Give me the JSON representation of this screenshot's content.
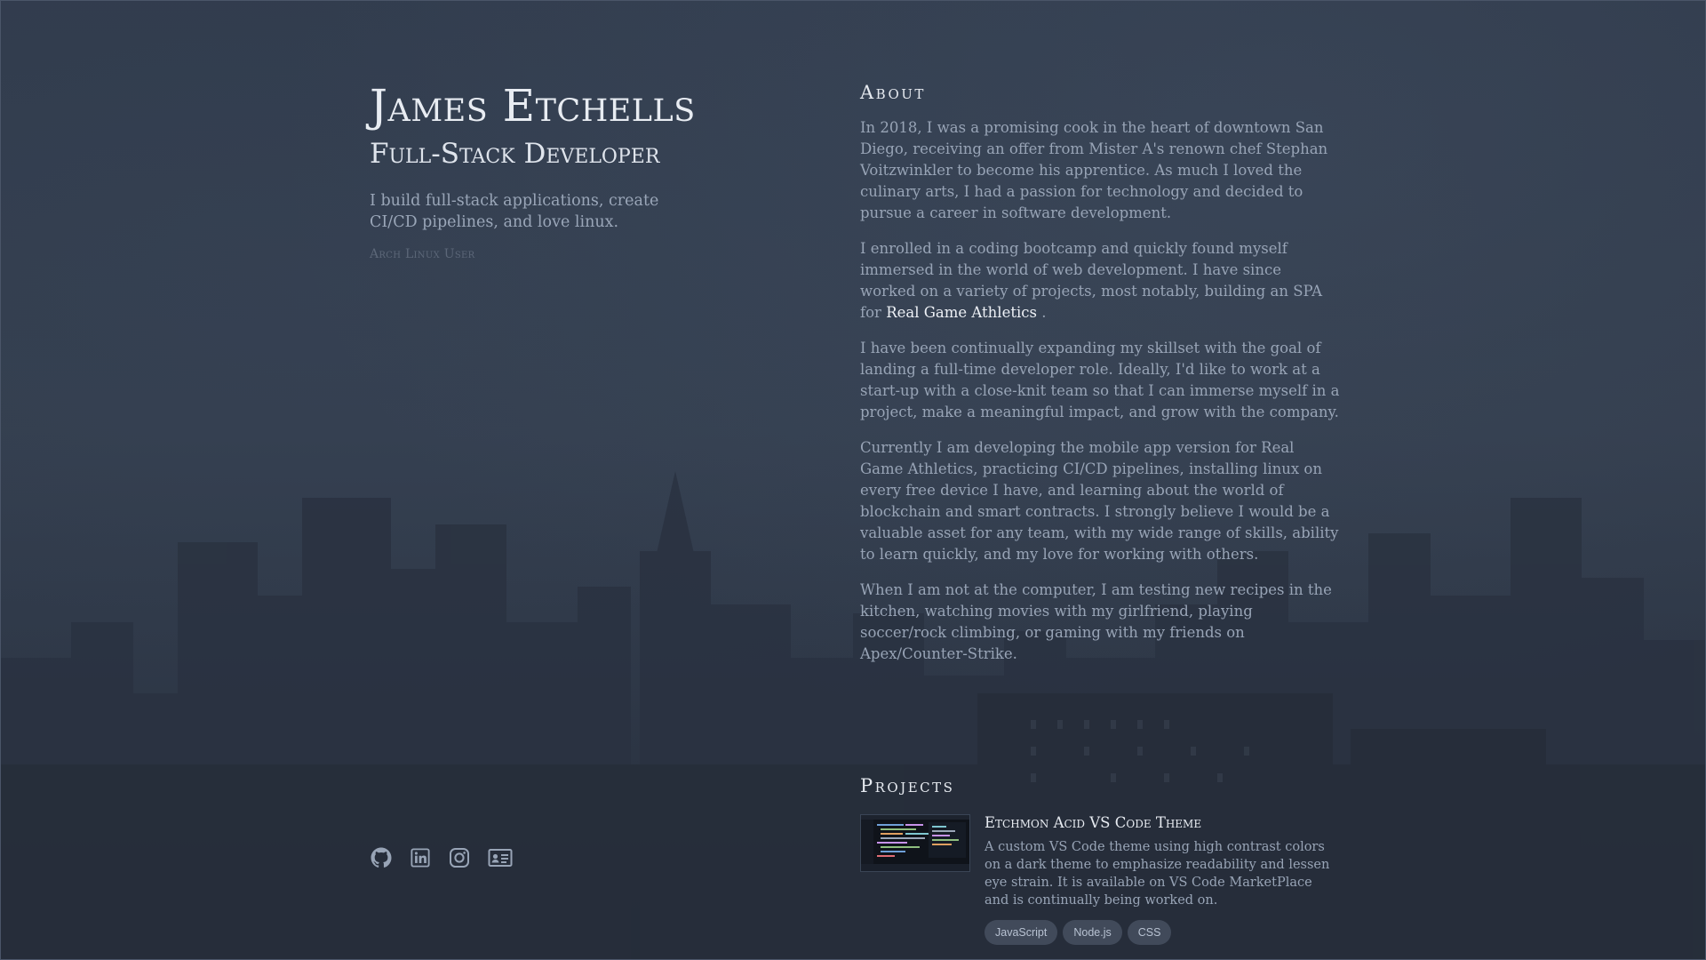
{
  "profile": {
    "name": "James Etchells",
    "role": "Full-Stack Developer",
    "tagline": "I build full-stack applications, create CI/CD pipelines, and love linux.",
    "note": "Arch Linux User"
  },
  "socials": [
    {
      "icon": "github-icon"
    },
    {
      "icon": "linkedin-icon"
    },
    {
      "icon": "instagram-icon"
    },
    {
      "icon": "resume-card-icon"
    }
  ],
  "about": {
    "title": "About",
    "p1": "In 2018, I was a promising cook in the heart of downtown San Diego, receiving an offer from Mister A's renown chef Stephan Voitzwinkler to become his apprentice. As much I loved the culinary arts, I had a passion for technology and decided to pursue a career in software development.",
    "p2_before": "I enrolled in a coding bootcamp and quickly found myself immersed in the world of web development. I have since worked on a variety of projects, most notably, building an SPA for ",
    "p2_link": "Real Game Athletics",
    "p2_after": " .",
    "p3": "I have been continually expanding my skillset with the goal of landing a full-time developer role. Ideally, I'd like to work at a start-up with a close-knit team so that I can immerse myself in a project, make a meaningful impact, and grow with the company.",
    "p4": "Currently I am developing the mobile app version for Real Game Athletics, practicing CI/CD pipelines, installing linux on every free device I have, and learning about the world of blockchain and smart contracts. I strongly believe I would be a valuable asset for any team, with my wide range of skills, ability to learn quickly, and my love for working with others.",
    "p5": "When I am not at the computer, I am testing new recipes in the kitchen, watching movies with my girlfriend, playing soccer/rock climbing, or gaming with my friends on Apex/Counter-Strike."
  },
  "projects": {
    "title": "Projects",
    "items": [
      {
        "title": "Etchmon Acid VS Code Theme",
        "description": "A custom VS Code theme using high contrast colors on a dark theme to emphasize readability and lessen eye strain. It is available on VS Code MarketPlace and is continually being worked on.",
        "tags": [
          "JavaScript",
          "Node.js",
          "CSS"
        ]
      }
    ]
  },
  "colors": {
    "background": "#2d3646",
    "heading": "#e8ecf2",
    "body_text": "#98a4b6",
    "muted": "#5c6778",
    "tag_bg": "#586274"
  }
}
